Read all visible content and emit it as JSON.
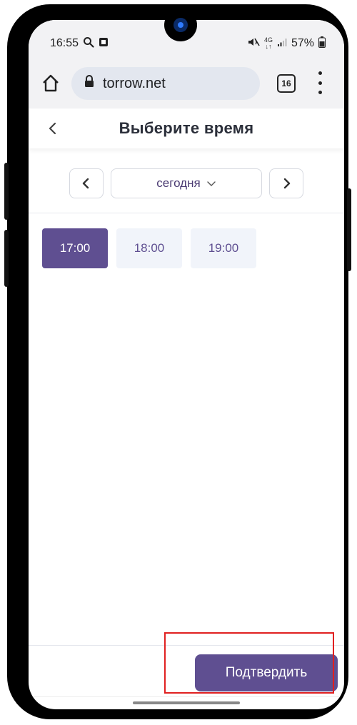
{
  "status_bar": {
    "time": "16:55",
    "network_top": "4G",
    "network_bottom": "↓↑",
    "battery": "57%"
  },
  "browser": {
    "url": "torrow.net",
    "tab_count": "16"
  },
  "page": {
    "title": "Выберите время"
  },
  "date_nav": {
    "selected_date": "сегодня"
  },
  "time_slots": [
    {
      "label": "17:00",
      "selected": true
    },
    {
      "label": "18:00",
      "selected": false
    },
    {
      "label": "19:00",
      "selected": false
    }
  ],
  "footer": {
    "confirm_label": "Подтвердить"
  },
  "colors": {
    "accent": "#5f4f91",
    "slot_background": "#f1f4fa",
    "highlight_frame": "#e02020"
  }
}
